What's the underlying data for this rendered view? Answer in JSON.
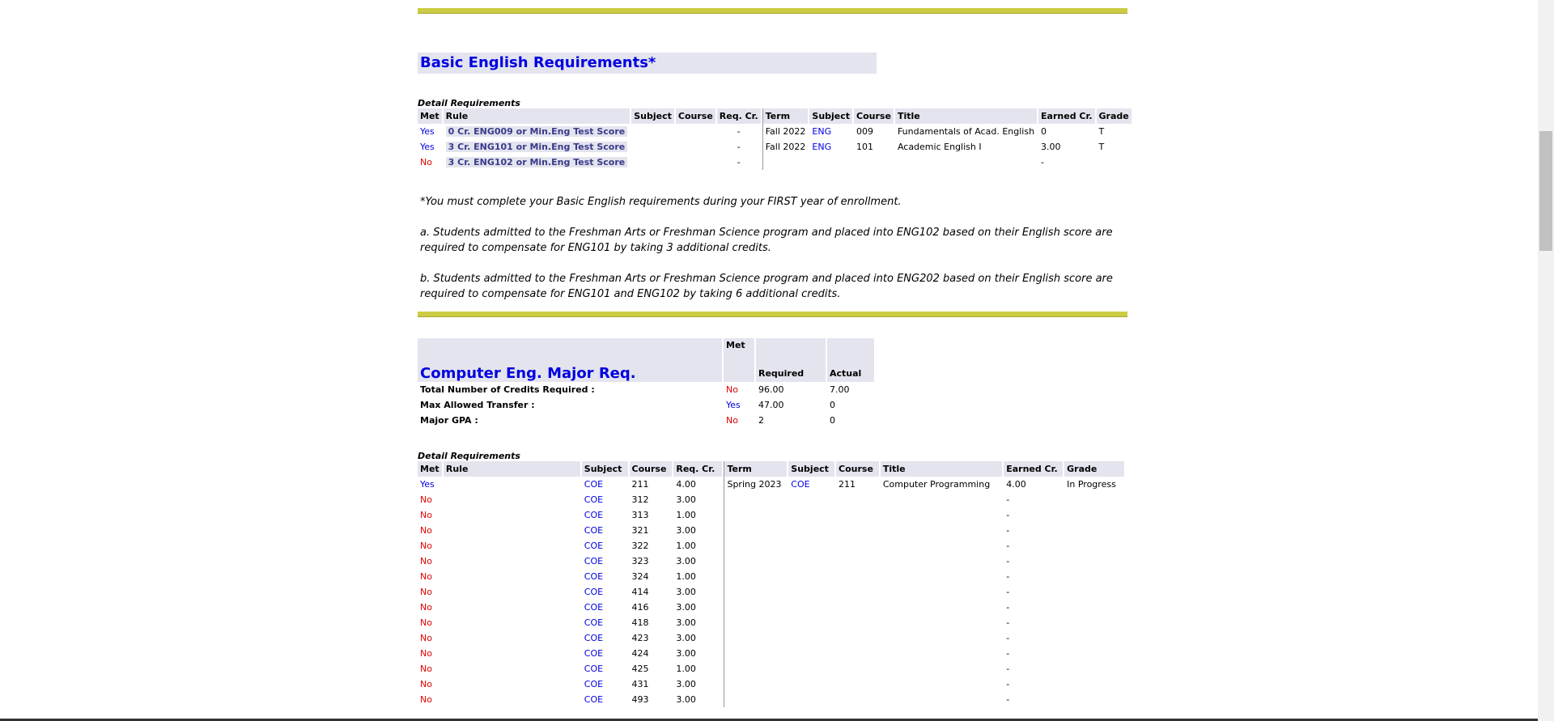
{
  "english": {
    "title": "Basic English Requirements*",
    "detail_label": "Detail Requirements",
    "headers": [
      "Met",
      "Rule",
      "Subject",
      "Course",
      "Req. Cr.",
      "Term",
      "Subject",
      "Course",
      "Title",
      "Earned Cr.",
      "Grade"
    ],
    "rows": [
      {
        "met": "Yes",
        "rule": "0 Cr. ENG009 or Min.Eng Test Score",
        "req": "-",
        "term": "Fall 2022",
        "subject": "ENG",
        "course": "009",
        "title": "Fundamentals of Acad. English",
        "earned": "0",
        "grade": "T"
      },
      {
        "met": "Yes",
        "rule": "3 Cr. ENG101 or Min.Eng Test Score",
        "req": "-",
        "term": "Fall 2022",
        "subject": "ENG",
        "course": "101",
        "title": "Academic English I",
        "earned": "3.00",
        "grade": "T"
      },
      {
        "met": "No",
        "rule": "3 Cr. ENG102 or Min.Eng Test Score",
        "req": "-",
        "term": "",
        "subject": "",
        "course": "",
        "title": "",
        "earned": "-",
        "grade": ""
      }
    ],
    "note_star": "*You must complete your Basic English requirements during your FIRST year of enrollment.",
    "note_a": "a. Students admitted to the Freshman Arts or Freshman Science program and placed into ENG102 based on their English score are required to compensate for ENG101 by taking 3 additional credits.",
    "note_b": "b. Students admitted to the Freshman Arts or Freshman Science program and placed into ENG202 based on their English score are required to compensate for ENG101 and ENG102 by taking 6 additional credits."
  },
  "major": {
    "title": "Computer Eng. Major Req.",
    "met_header": "Met",
    "required_header": "Required",
    "actual_header": "Actual",
    "summary": [
      {
        "label": "Total Number of Credits Required :",
        "met": "No",
        "required": "96.00",
        "actual": "7.00"
      },
      {
        "label": "Max Allowed Transfer :",
        "met": "Yes",
        "required": "47.00",
        "actual": "0"
      },
      {
        "label": "Major GPA :",
        "met": "No",
        "required": "2",
        "actual": "0"
      }
    ],
    "detail_label": "Detail Requirements",
    "headers": [
      "Met",
      "Rule",
      "Subject",
      "Course",
      "Req. Cr.",
      "Term",
      "Subject",
      "Course",
      "Title",
      "Earned Cr.",
      "Grade"
    ],
    "rows": [
      {
        "met": "Yes",
        "subject": "COE",
        "course": "211",
        "req": "4.00",
        "term": "Spring 2023",
        "t_subject": "COE",
        "t_course": "211",
        "title": "Computer Programming",
        "earned": "4.00",
        "grade": "In Progress"
      },
      {
        "met": "No",
        "subject": "COE",
        "course": "312",
        "req": "3.00",
        "earned": "-"
      },
      {
        "met": "No",
        "subject": "COE",
        "course": "313",
        "req": "1.00",
        "earned": "-"
      },
      {
        "met": "No",
        "subject": "COE",
        "course": "321",
        "req": "3.00",
        "earned": "-"
      },
      {
        "met": "No",
        "subject": "COE",
        "course": "322",
        "req": "1.00",
        "earned": "-"
      },
      {
        "met": "No",
        "subject": "COE",
        "course": "323",
        "req": "3.00",
        "earned": "-"
      },
      {
        "met": "No",
        "subject": "COE",
        "course": "324",
        "req": "1.00",
        "earned": "-"
      },
      {
        "met": "No",
        "subject": "COE",
        "course": "414",
        "req": "3.00",
        "earned": "-"
      },
      {
        "met": "No",
        "subject": "COE",
        "course": "416",
        "req": "3.00",
        "earned": "-"
      },
      {
        "met": "No",
        "subject": "COE",
        "course": "418",
        "req": "3.00",
        "earned": "-"
      },
      {
        "met": "No",
        "subject": "COE",
        "course": "423",
        "req": "3.00",
        "earned": "-"
      },
      {
        "met": "No",
        "subject": "COE",
        "course": "424",
        "req": "3.00",
        "earned": "-"
      },
      {
        "met": "No",
        "subject": "COE",
        "course": "425",
        "req": "1.00",
        "earned": "-"
      },
      {
        "met": "No",
        "subject": "COE",
        "course": "431",
        "req": "3.00",
        "earned": "-"
      },
      {
        "met": "No",
        "subject": "COE",
        "course": "493",
        "req": "3.00",
        "earned": "-"
      }
    ]
  },
  "colors": {
    "accent_bar": "#cccc44",
    "header_bg": "#e3e4ee",
    "yes": "#0000e0",
    "no": "#e00000"
  }
}
